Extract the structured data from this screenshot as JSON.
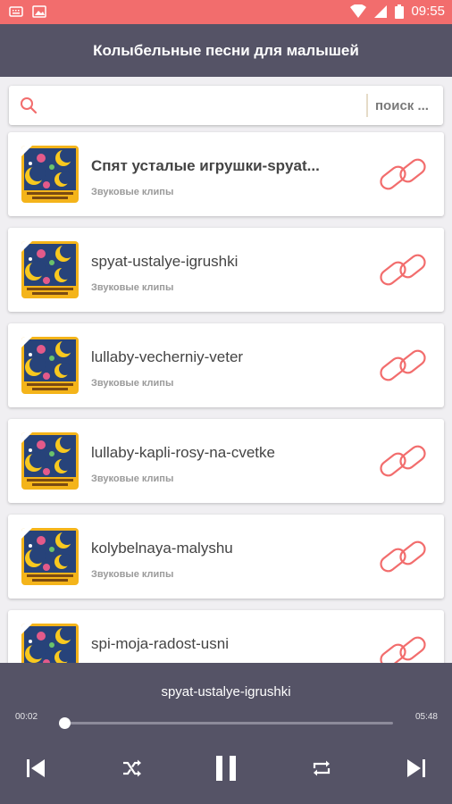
{
  "status_bar": {
    "time": "09:55",
    "icons": [
      "keyboard-icon",
      "image-icon",
      "wifi-icon",
      "signal-icon",
      "battery-icon"
    ]
  },
  "app_bar": {
    "title": "Колыбельные песни для малышей"
  },
  "search": {
    "placeholder": "поиск ..."
  },
  "items": [
    {
      "title": "Спят усталые игрушки-spyat...",
      "subtitle": "Звуковые клипы",
      "bold": true
    },
    {
      "title": "spyat-ustalye-igrushki",
      "subtitle": "Звуковые клипы",
      "bold": false
    },
    {
      "title": "lullaby-vecherniy-veter",
      "subtitle": "Звуковые клипы",
      "bold": false
    },
    {
      "title": "lullaby-kapli-rosy-na-cvetke",
      "subtitle": "Звуковые клипы",
      "bold": false
    },
    {
      "title": "kolybelnaya-malyshu",
      "subtitle": "Звуковые клипы",
      "bold": false
    },
    {
      "title": "spi-moja-radost-usni",
      "subtitle": "Звуковые клипы",
      "bold": false
    }
  ],
  "player": {
    "track_title": "spyat-ustalye-igrushki",
    "elapsed": "00:02",
    "duration": "05:48",
    "progress_fraction": 0.006,
    "controls": [
      "skip-previous-icon",
      "shuffle-icon",
      "pause-icon",
      "repeat-icon",
      "skip-next-icon"
    ]
  },
  "colors": {
    "status_bar": "#f26d6d",
    "app_bar": "#555366",
    "accent": "#f26d6d",
    "background": "#f0eff2"
  }
}
